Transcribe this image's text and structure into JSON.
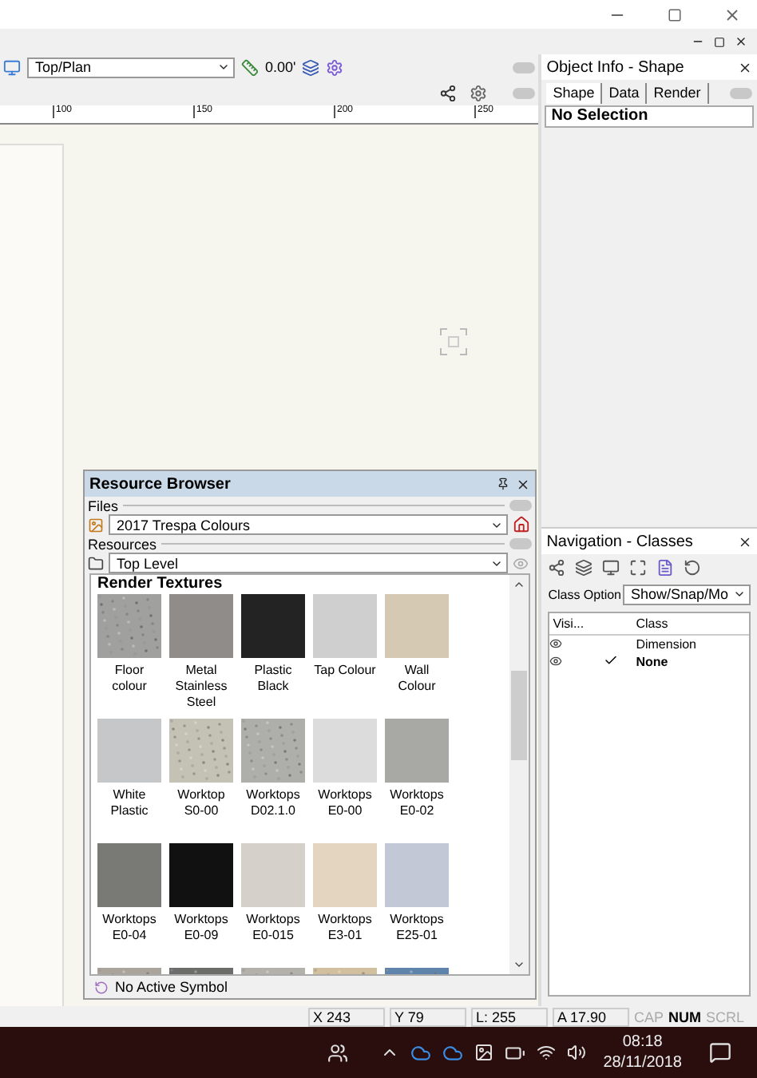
{
  "toolbar": {
    "view": "Top/Plan",
    "angle": "0.00'"
  },
  "ruler": [
    "100",
    "150",
    "200",
    "250"
  ],
  "resource_browser": {
    "title": "Resource Browser",
    "files_label": "Files",
    "file": "2017 Trespa Colours",
    "resources_label": "Resources",
    "folder": "Top Level",
    "section": "Render Textures",
    "footer": "No Active Symbol",
    "textures": [
      {
        "name": "Floor\ncolour",
        "color": "#a0a09f",
        "textured": true
      },
      {
        "name": "Metal\nStainless\nSteel",
        "color": "#8f8c89",
        "textured": false
      },
      {
        "name": "Plastic\nBlack",
        "color": "#242324",
        "textured": false
      },
      {
        "name": "Tap Colour",
        "color": "#cfcfd0",
        "textured": false
      },
      {
        "name": "Wall\nColour",
        "color": "#d6c9b4",
        "textured": false
      },
      {
        "name": "White\nPlastic",
        "color": "#c6c7c9",
        "textured": false
      },
      {
        "name": "Worktop\nS0-00",
        "color": "#c4c2b5",
        "textured": true
      },
      {
        "name": "Worktops\nD02.1.0",
        "color": "#aeaeab",
        "textured": true
      },
      {
        "name": "Worktops\nE0-00",
        "color": "#dcdcdd",
        "textured": false
      },
      {
        "name": "Worktops\nE0-02",
        "color": "#a8a8a4",
        "textured": false
      },
      {
        "name": "Worktops\nE0-04",
        "color": "#797976",
        "textured": false
      },
      {
        "name": "Worktops\nE0-09",
        "color": "#111111",
        "textured": false
      },
      {
        "name": "Worktops\nE0-015",
        "color": "#d6d0ca",
        "textured": false
      },
      {
        "name": "Worktops\nE3-01",
        "color": "#e3d5bf",
        "textured": false
      },
      {
        "name": "Worktops\nE25-01",
        "color": "#c2c8d6",
        "textured": false
      },
      {
        "color": "#aaa49d",
        "textured": true
      },
      {
        "color": "#6c6c6a",
        "textured": true
      },
      {
        "color": "#b3b2aa",
        "textured": true
      },
      {
        "color": "#d2bf9e",
        "textured": true
      },
      {
        "color": "#5f84ac",
        "textured": true
      }
    ]
  },
  "object_info": {
    "title": "Object Info - Shape",
    "tabs": [
      {
        "label": "Shape",
        "selected": true
      },
      {
        "label": "Data",
        "selected": false
      },
      {
        "label": "Render",
        "selected": false
      }
    ],
    "selection": "No Selection"
  },
  "navigation": {
    "title": "Navigation - Classes",
    "options_label": "Class Option",
    "options_value": "Show/Snap/Mo",
    "columns": [
      "Visi...",
      "Class"
    ],
    "rows": [
      {
        "name": "Dimension",
        "visible": true,
        "active": false
      },
      {
        "name": "None",
        "visible": true,
        "active": true
      }
    ]
  },
  "status_bar": {
    "cells": [
      "X 243",
      "Y 79",
      "L: 255",
      "A 17.90"
    ],
    "keys": [
      {
        "label": "CAP",
        "on": false
      },
      {
        "label": "NUM",
        "on": true
      },
      {
        "label": "SCRL",
        "on": false
      }
    ]
  },
  "taskbar": {
    "time": "08:18",
    "date": "28/11/2018"
  }
}
